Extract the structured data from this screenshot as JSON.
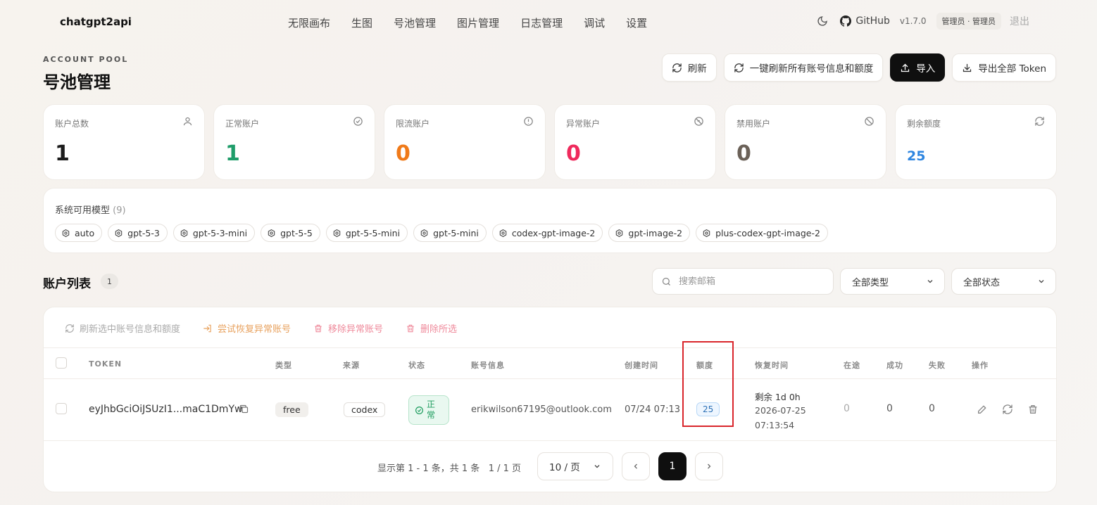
{
  "brand": "chatgpt2api",
  "nav": [
    "无限画布",
    "生图",
    "号池管理",
    "图片管理",
    "日志管理",
    "调试",
    "设置"
  ],
  "top": {
    "github": "GitHub",
    "version": "v1.7.0",
    "role": "管理员 · 管理员",
    "logout": "退出"
  },
  "header": {
    "eyebrow": "ACCOUNT POOL",
    "title": "号池管理"
  },
  "actions": {
    "refresh": "刷新",
    "refresh_all": "一键刷新所有账号信息和额度",
    "import": "导入",
    "export": "导出全部 Token"
  },
  "stats": [
    {
      "label": "账户总数",
      "value": "1",
      "icon": "user-icon",
      "color": "#1c1c1c"
    },
    {
      "label": "正常账户",
      "value": "1",
      "icon": "check-circle-icon",
      "color": "#1f9d6a"
    },
    {
      "label": "限流账户",
      "value": "0",
      "icon": "alert-circle-icon",
      "color": "#f07a19"
    },
    {
      "label": "异常账户",
      "value": "0",
      "icon": "wifi-off-icon",
      "color": "#ef2a5c"
    },
    {
      "label": "禁用账户",
      "value": "0",
      "icon": "ban-icon",
      "color": "#6b6158"
    },
    {
      "label": "剩余额度",
      "value": "25",
      "icon": "refresh-icon",
      "color": "#2f86e0"
    }
  ],
  "models": {
    "label": "系统可用模型",
    "count": "(9)",
    "items": [
      "auto",
      "gpt-5-3",
      "gpt-5-3-mini",
      "gpt-5-5",
      "gpt-5-5-mini",
      "gpt-5-mini",
      "codex-gpt-image-2",
      "gpt-image-2",
      "plus-codex-gpt-image-2"
    ]
  },
  "list": {
    "title": "账户列表",
    "count": "1",
    "search_placeholder": "搜索邮箱",
    "type_filter": "全部类型",
    "status_filter": "全部状态"
  },
  "bulk": {
    "refresh_selected": "刷新选中账号信息和额度",
    "try_recover": "尝试恢复异常账号",
    "remove_abnormal": "移除异常账号",
    "delete_selected": "删除所选"
  },
  "columns": {
    "token": "TOKEN",
    "type": "类型",
    "source": "来源",
    "status": "状态",
    "account_info": "账号信息",
    "created": "创建时间",
    "quota": "额度",
    "recover_time": "恢复时间",
    "in_flight": "在途",
    "success": "成功",
    "fail": "失败",
    "ops": "操作"
  },
  "rows": [
    {
      "token": "eyJhbGciOiJSUzI1...maC1DmYw",
      "type": "free",
      "source": "codex",
      "status": "正常",
      "email": "erikwilson67195@outlook.com",
      "created": "07/24 07:13",
      "quota": "25",
      "recover_remaining": "剩余 1d 0h",
      "recover_date": "2026-07-25",
      "recover_time": "07:13:54",
      "in_flight": "0",
      "success": "0",
      "fail": "0"
    }
  ],
  "pager": {
    "summary": "显示第 1 - 1 条，共 1 条   1 / 1 页",
    "page_size": "10 / 页",
    "current": "1"
  }
}
